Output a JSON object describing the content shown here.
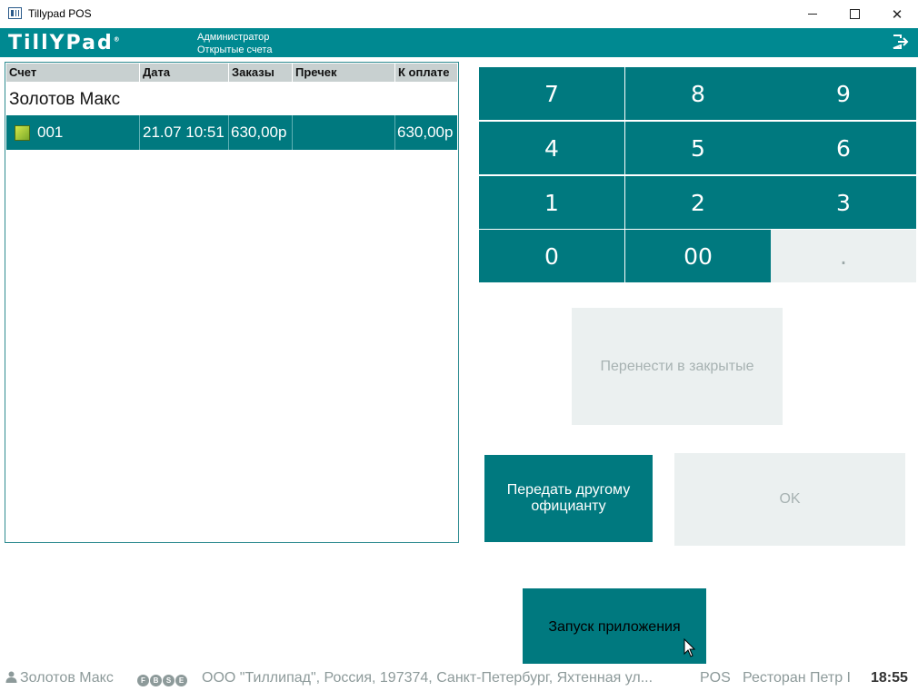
{
  "window": {
    "title": "Tillypad POS",
    "close_glyph": "✕"
  },
  "header": {
    "logo": "TillYPad",
    "logo_mark": "®",
    "user": "Администратор",
    "subtitle": "Открытые счета",
    "logout_icon": "logout-icon"
  },
  "table": {
    "columns": [
      "Счет",
      "Дата",
      "Заказы",
      "Пречек",
      "К оплате"
    ],
    "group": "Золотов Макс",
    "rows": [
      {
        "account": "001",
        "date": "21.07 10:51",
        "orders": "630,00р",
        "precheck": "",
        "to_pay": "630,00р"
      }
    ]
  },
  "keypad": {
    "keys": [
      "7",
      "8",
      "9",
      "4",
      "5",
      "6",
      "1",
      "2",
      "3",
      "0",
      "00",
      "."
    ]
  },
  "actions": {
    "move_closed": "Перенести в закрытые",
    "transfer": "Передать другому официанту",
    "ok": "OK",
    "launch": "Запуск приложения"
  },
  "status": {
    "user": "Золотов Макс",
    "badges": [
      "F",
      "B",
      "S",
      "E"
    ],
    "org": "ООО \"Тиллипад\", Россия, 197374, Санкт-Петербург, Яхтенная ул...",
    "terminal": "POS",
    "restaurant": "Ресторан Петр I",
    "time": "18:55"
  },
  "colors": {
    "accent": "#008991",
    "button": "#00797f",
    "disabled_bg": "#ebf0f0",
    "status_text": "#8d9a9a"
  }
}
